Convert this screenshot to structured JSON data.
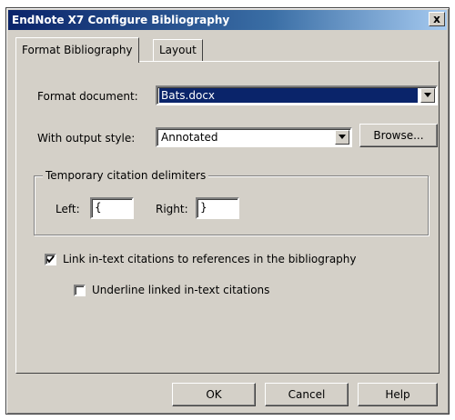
{
  "window": {
    "title": "EndNote X7 Configure Bibliography",
    "close_glyph": "x"
  },
  "tabs": [
    {
      "label": "Format Bibliography",
      "active": true
    },
    {
      "label": "Layout",
      "active": false
    }
  ],
  "format_document": {
    "label": "Format document:",
    "value": "Bats.docx"
  },
  "output_style": {
    "label": "With output style:",
    "value": "Annotated",
    "browse_label": "Browse..."
  },
  "delimiters": {
    "title": "Temporary citation delimiters",
    "left_label": "Left:",
    "left_value": "{",
    "right_label": "Right:",
    "right_value": "}"
  },
  "options": {
    "link_label": "Link in-text citations to references in the bibliography",
    "link_checked": true,
    "underline_label": "Underline linked in-text citations",
    "underline_checked": false
  },
  "footer": {
    "ok_label": "OK",
    "cancel_label": "Cancel",
    "help_label": "Help"
  },
  "icons": {
    "dropdown": "chevron-down-icon",
    "check": "checkmark-icon"
  },
  "colors": {
    "dialog_bg": "#d4d0c8",
    "title_bar": "#0a246a",
    "selection": "#0a246a"
  }
}
